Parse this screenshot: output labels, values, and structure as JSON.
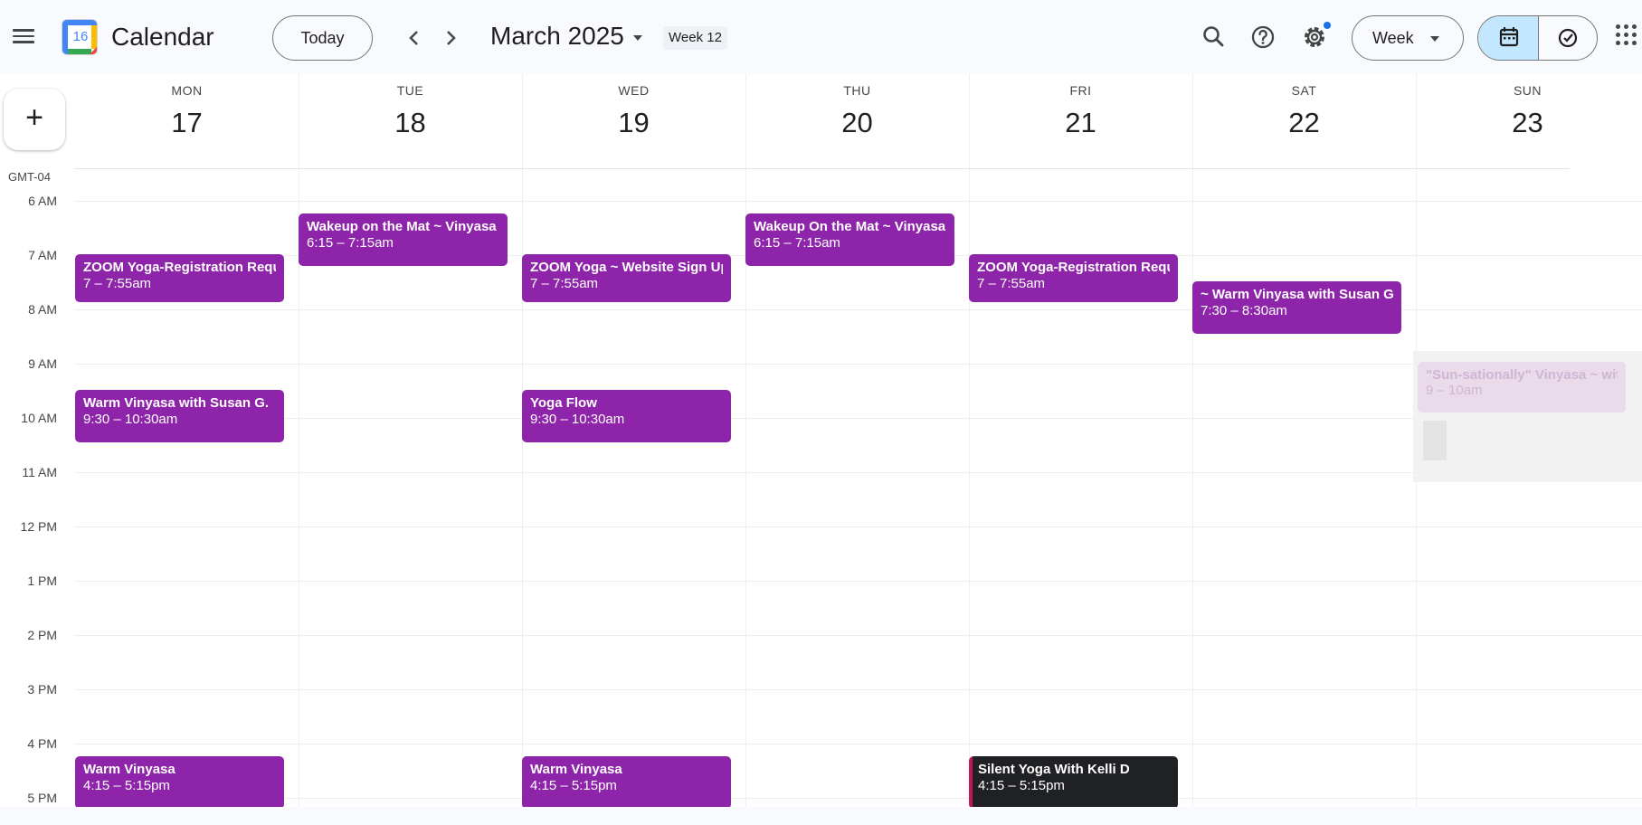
{
  "header": {
    "app_title": "Calendar",
    "logo_day": "16",
    "today_label": "Today",
    "prev_label": "‹",
    "next_label": "›",
    "period_label": "March 2025",
    "week_label": "Week 12",
    "view_label": "Week",
    "icons": [
      "menu-icon",
      "search-icon",
      "help-icon",
      "gear-icon",
      "calendar-icon",
      "tasks-icon",
      "apps-icon"
    ],
    "accent_color": "#c2e7ff"
  },
  "create_label": "+",
  "timezone": "GMT-04",
  "days": [
    {
      "name": "MON",
      "num": "17"
    },
    {
      "name": "TUE",
      "num": "18"
    },
    {
      "name": "WED",
      "num": "19"
    },
    {
      "name": "THU",
      "num": "20"
    },
    {
      "name": "FRI",
      "num": "21"
    },
    {
      "name": "SAT",
      "num": "22"
    },
    {
      "name": "SUN",
      "num": "23"
    }
  ],
  "hours": [
    "6 AM",
    "7 AM",
    "8 AM",
    "9 AM",
    "10 AM",
    "11 AM",
    "12 PM",
    "1 PM",
    "2 PM",
    "3 PM",
    "4 PM",
    "5 PM"
  ],
  "events": [
    {
      "title": "Wakeup on the Mat ~ Vinyasa f",
      "time": "6:15 – 7:15am"
    },
    {
      "title": "Wakeup On the Mat ~ Vinyasa f",
      "time": "6:15 – 7:15am"
    },
    {
      "title": "ZOOM Yoga-Registration Requi",
      "time": "7 – 7:55am"
    },
    {
      "title": "ZOOM Yoga ~ Website Sign Up i",
      "time": "7 – 7:55am"
    },
    {
      "title": "ZOOM Yoga-Registration Requi",
      "time": "7 – 7:55am"
    },
    {
      "title": "~ Warm Vinyasa with Susan G. ~",
      "time": "7:30 – 8:30am"
    },
    {
      "title": "Warm Vinyasa with Susan G.",
      "time": "9:30 – 10:30am"
    },
    {
      "title": "Yoga Flow",
      "time": "9:30 – 10:30am"
    },
    {
      "title": "\"Sun-sationally\" Vinyasa ~ with",
      "time": "9 – 10am"
    },
    {
      "title": "Warm Vinyasa",
      "time": "4:15 – 5:15pm"
    },
    {
      "title": "Warm Vinyasa",
      "time": "4:15 – 5:15pm"
    },
    {
      "title": "Silent Yoga With Kelli D",
      "time": "4:15 – 5:15pm"
    }
  ],
  "colors": {
    "event": "#8e24aa",
    "event_dark": "#202124",
    "event_dark_stripe": "#c2185b"
  }
}
